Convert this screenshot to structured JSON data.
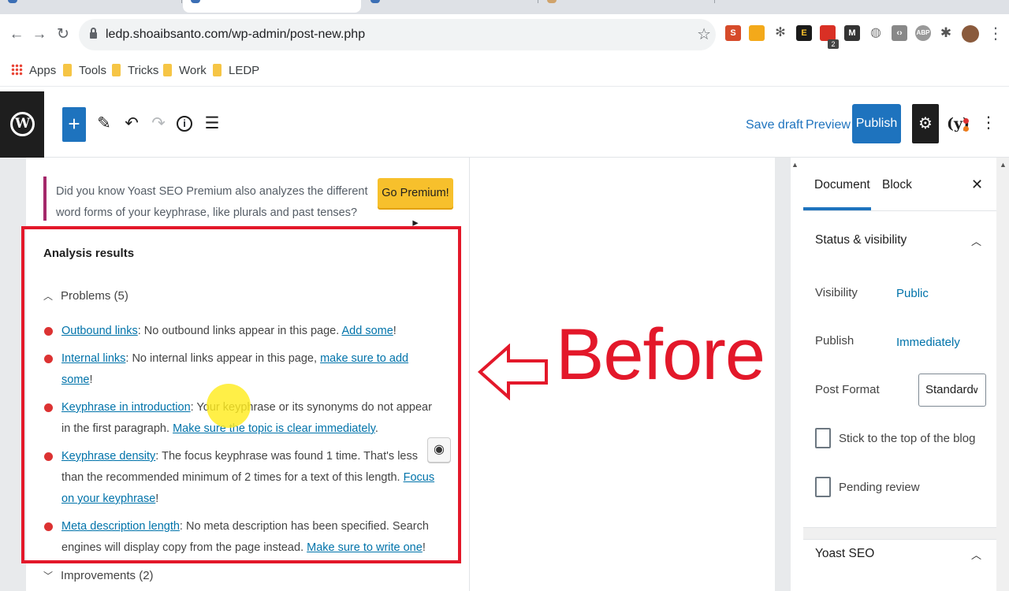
{
  "browser": {
    "url": "ledp.shoaibsanto.com/wp-admin/post-new.php",
    "bookmarks": [
      "Apps",
      "Tools",
      "Tricks",
      "Work",
      "LEDP"
    ],
    "extension_badge": "2"
  },
  "toolbar": {
    "save_draft": "Save draft",
    "preview": "Preview",
    "publish": "Publish"
  },
  "yoast_panel": {
    "premium_note": "Did you know Yoast SEO Premium also analyzes the different word forms of your keyphrase, like plurals and past tenses?",
    "go_premium": "Go Premium! ▸",
    "analysis_title": "Analysis results",
    "problems_label": "Problems (5)",
    "improvements_label": "Improvements (2)",
    "problems": [
      {
        "link": "Outbound links",
        "text": ": No outbound links appear in this page. ",
        "action": "Add some",
        "end": "!"
      },
      {
        "link": "Internal links",
        "text": ": No internal links appear in this page, ",
        "action": "make sure to add some",
        "end": "!"
      },
      {
        "link": "Keyphrase in introduction",
        "text": ": Your keyphrase or its synonyms do not appear in the first paragraph. ",
        "action": "Make sure the topic is clear immediately",
        "end": "."
      },
      {
        "link": "Keyphrase density",
        "text": ": The focus keyphrase was found 1 time. That's less than the recommended minimum of 2 times for a text of this length. ",
        "action": "Focus on your keyphrase",
        "end": "!"
      },
      {
        "link": "Meta description length",
        "text": ": No meta description has been specified. Search engines will display copy from the page instead. ",
        "action": "Make sure to write one",
        "end": "!"
      }
    ]
  },
  "annotation": {
    "before_text": "Before",
    "color": "#e3182a"
  },
  "sidebar": {
    "tabs": [
      "Document",
      "Block"
    ],
    "status_title": "Status & visibility",
    "visibility_label": "Visibility",
    "visibility_value": "Public",
    "publish_label": "Publish",
    "publish_value": "Immediately",
    "post_format_label": "Post Format",
    "post_format_value": "Standard",
    "sticky_label": "Stick to the top of the blog",
    "pending_label": "Pending review",
    "yoast_title": "Yoast SEO"
  },
  "colors": {
    "wp_blue": "#1e73be",
    "problem_red": "#dc3232",
    "link": "#0073aa",
    "yoast_purple": "#a4286a",
    "premium_yellow": "#f7c02c"
  }
}
